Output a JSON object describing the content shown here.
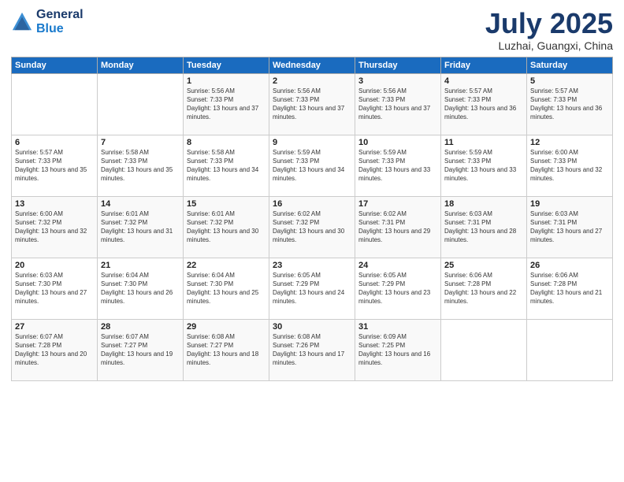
{
  "logo": {
    "general": "General",
    "blue": "Blue"
  },
  "header": {
    "month": "July 2025",
    "location": "Luzhai, Guangxi, China"
  },
  "weekdays": [
    "Sunday",
    "Monday",
    "Tuesday",
    "Wednesday",
    "Thursday",
    "Friday",
    "Saturday"
  ],
  "weeks": [
    [
      {
        "day": "",
        "sunrise": "",
        "sunset": "",
        "daylight": ""
      },
      {
        "day": "",
        "sunrise": "",
        "sunset": "",
        "daylight": ""
      },
      {
        "day": "1",
        "sunrise": "Sunrise: 5:56 AM",
        "sunset": "Sunset: 7:33 PM",
        "daylight": "Daylight: 13 hours and 37 minutes."
      },
      {
        "day": "2",
        "sunrise": "Sunrise: 5:56 AM",
        "sunset": "Sunset: 7:33 PM",
        "daylight": "Daylight: 13 hours and 37 minutes."
      },
      {
        "day": "3",
        "sunrise": "Sunrise: 5:56 AM",
        "sunset": "Sunset: 7:33 PM",
        "daylight": "Daylight: 13 hours and 37 minutes."
      },
      {
        "day": "4",
        "sunrise": "Sunrise: 5:57 AM",
        "sunset": "Sunset: 7:33 PM",
        "daylight": "Daylight: 13 hours and 36 minutes."
      },
      {
        "day": "5",
        "sunrise": "Sunrise: 5:57 AM",
        "sunset": "Sunset: 7:33 PM",
        "daylight": "Daylight: 13 hours and 36 minutes."
      }
    ],
    [
      {
        "day": "6",
        "sunrise": "Sunrise: 5:57 AM",
        "sunset": "Sunset: 7:33 PM",
        "daylight": "Daylight: 13 hours and 35 minutes."
      },
      {
        "day": "7",
        "sunrise": "Sunrise: 5:58 AM",
        "sunset": "Sunset: 7:33 PM",
        "daylight": "Daylight: 13 hours and 35 minutes."
      },
      {
        "day": "8",
        "sunrise": "Sunrise: 5:58 AM",
        "sunset": "Sunset: 7:33 PM",
        "daylight": "Daylight: 13 hours and 34 minutes."
      },
      {
        "day": "9",
        "sunrise": "Sunrise: 5:59 AM",
        "sunset": "Sunset: 7:33 PM",
        "daylight": "Daylight: 13 hours and 34 minutes."
      },
      {
        "day": "10",
        "sunrise": "Sunrise: 5:59 AM",
        "sunset": "Sunset: 7:33 PM",
        "daylight": "Daylight: 13 hours and 33 minutes."
      },
      {
        "day": "11",
        "sunrise": "Sunrise: 5:59 AM",
        "sunset": "Sunset: 7:33 PM",
        "daylight": "Daylight: 13 hours and 33 minutes."
      },
      {
        "day": "12",
        "sunrise": "Sunrise: 6:00 AM",
        "sunset": "Sunset: 7:33 PM",
        "daylight": "Daylight: 13 hours and 32 minutes."
      }
    ],
    [
      {
        "day": "13",
        "sunrise": "Sunrise: 6:00 AM",
        "sunset": "Sunset: 7:32 PM",
        "daylight": "Daylight: 13 hours and 32 minutes."
      },
      {
        "day": "14",
        "sunrise": "Sunrise: 6:01 AM",
        "sunset": "Sunset: 7:32 PM",
        "daylight": "Daylight: 13 hours and 31 minutes."
      },
      {
        "day": "15",
        "sunrise": "Sunrise: 6:01 AM",
        "sunset": "Sunset: 7:32 PM",
        "daylight": "Daylight: 13 hours and 30 minutes."
      },
      {
        "day": "16",
        "sunrise": "Sunrise: 6:02 AM",
        "sunset": "Sunset: 7:32 PM",
        "daylight": "Daylight: 13 hours and 30 minutes."
      },
      {
        "day": "17",
        "sunrise": "Sunrise: 6:02 AM",
        "sunset": "Sunset: 7:31 PM",
        "daylight": "Daylight: 13 hours and 29 minutes."
      },
      {
        "day": "18",
        "sunrise": "Sunrise: 6:03 AM",
        "sunset": "Sunset: 7:31 PM",
        "daylight": "Daylight: 13 hours and 28 minutes."
      },
      {
        "day": "19",
        "sunrise": "Sunrise: 6:03 AM",
        "sunset": "Sunset: 7:31 PM",
        "daylight": "Daylight: 13 hours and 27 minutes."
      }
    ],
    [
      {
        "day": "20",
        "sunrise": "Sunrise: 6:03 AM",
        "sunset": "Sunset: 7:30 PM",
        "daylight": "Daylight: 13 hours and 27 minutes."
      },
      {
        "day": "21",
        "sunrise": "Sunrise: 6:04 AM",
        "sunset": "Sunset: 7:30 PM",
        "daylight": "Daylight: 13 hours and 26 minutes."
      },
      {
        "day": "22",
        "sunrise": "Sunrise: 6:04 AM",
        "sunset": "Sunset: 7:30 PM",
        "daylight": "Daylight: 13 hours and 25 minutes."
      },
      {
        "day": "23",
        "sunrise": "Sunrise: 6:05 AM",
        "sunset": "Sunset: 7:29 PM",
        "daylight": "Daylight: 13 hours and 24 minutes."
      },
      {
        "day": "24",
        "sunrise": "Sunrise: 6:05 AM",
        "sunset": "Sunset: 7:29 PM",
        "daylight": "Daylight: 13 hours and 23 minutes."
      },
      {
        "day": "25",
        "sunrise": "Sunrise: 6:06 AM",
        "sunset": "Sunset: 7:28 PM",
        "daylight": "Daylight: 13 hours and 22 minutes."
      },
      {
        "day": "26",
        "sunrise": "Sunrise: 6:06 AM",
        "sunset": "Sunset: 7:28 PM",
        "daylight": "Daylight: 13 hours and 21 minutes."
      }
    ],
    [
      {
        "day": "27",
        "sunrise": "Sunrise: 6:07 AM",
        "sunset": "Sunset: 7:28 PM",
        "daylight": "Daylight: 13 hours and 20 minutes."
      },
      {
        "day": "28",
        "sunrise": "Sunrise: 6:07 AM",
        "sunset": "Sunset: 7:27 PM",
        "daylight": "Daylight: 13 hours and 19 minutes."
      },
      {
        "day": "29",
        "sunrise": "Sunrise: 6:08 AM",
        "sunset": "Sunset: 7:27 PM",
        "daylight": "Daylight: 13 hours and 18 minutes."
      },
      {
        "day": "30",
        "sunrise": "Sunrise: 6:08 AM",
        "sunset": "Sunset: 7:26 PM",
        "daylight": "Daylight: 13 hours and 17 minutes."
      },
      {
        "day": "31",
        "sunrise": "Sunrise: 6:09 AM",
        "sunset": "Sunset: 7:25 PM",
        "daylight": "Daylight: 13 hours and 16 minutes."
      },
      {
        "day": "",
        "sunrise": "",
        "sunset": "",
        "daylight": ""
      },
      {
        "day": "",
        "sunrise": "",
        "sunset": "",
        "daylight": ""
      }
    ]
  ]
}
